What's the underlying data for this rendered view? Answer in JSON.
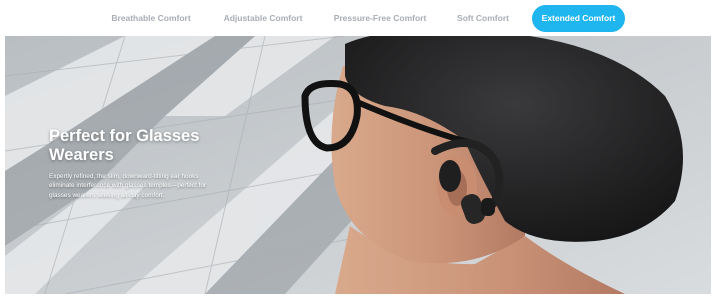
{
  "tabs": [
    {
      "label": "Breathable Comfort"
    },
    {
      "label": "Adjustable Comfort"
    },
    {
      "label": "Pressure-Free Comfort"
    },
    {
      "label": "Soft Comfort"
    },
    {
      "label": "Extended Comfort",
      "active": true
    }
  ],
  "hero": {
    "title_line1": "Perfect for Glasses",
    "title_line2": "Wearers",
    "body_line1": "Expertly refined, the slim, downward-tilting ear hooks",
    "body_line2": "eliminate interference with glasses temples—perfect for",
    "body_line3": "glasses wearers seeking all-day comfort."
  },
  "colors": {
    "active_tab": "#1fb5ef",
    "inactive_tab_text": "#a8aeb6",
    "hero_text": "#ffffff"
  },
  "icons": [
    "earbud-product-image"
  ]
}
